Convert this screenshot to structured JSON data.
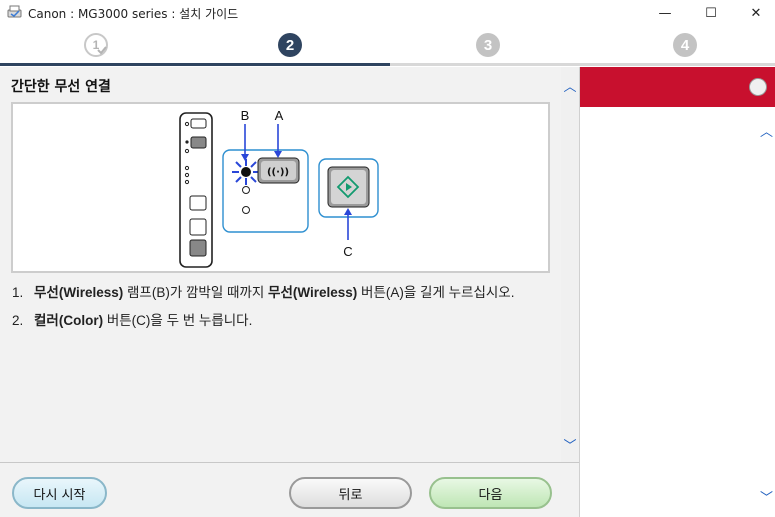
{
  "window": {
    "title": "Canon : MG3000 series : 설치 가이드",
    "min_glyph": "—",
    "max_glyph": "☐",
    "close_glyph": "✕"
  },
  "steps": [
    {
      "label": "1",
      "state": "completed"
    },
    {
      "label": "2",
      "state": "current"
    },
    {
      "label": "3",
      "state": "upcoming"
    },
    {
      "label": "4",
      "state": "upcoming"
    }
  ],
  "main": {
    "section_title": "간단한 무선 연결",
    "figure_labels": {
      "b": "B",
      "a": "A",
      "c": "C"
    },
    "instructions": [
      {
        "num": "1.",
        "pre": "",
        "bold1": "무선(Wireless)",
        "mid": " 램프(B)가 깜박일 때까지 ",
        "bold2": "무선(Wireless)",
        "post": " 버튼(A)을 길게 누르십시오."
      },
      {
        "num": "2.",
        "pre": "",
        "bold1": "컬러(Color)",
        "mid": " 버튼(C)을 두 번 누릅니다.",
        "bold2": "",
        "post": ""
      }
    ]
  },
  "footer": {
    "restart_label": "다시 시작",
    "back_label": "뒤로",
    "next_label": "다음"
  },
  "colors": {
    "step_active": "#2f4460",
    "brand_red": "#c8102e",
    "scroll_arrow": "#1f5fbf"
  },
  "icons": [
    "app-icon",
    "checkmark-icon",
    "wifi-icon",
    "color-start-icon",
    "scroll-up-icon",
    "scroll-down-icon"
  ]
}
